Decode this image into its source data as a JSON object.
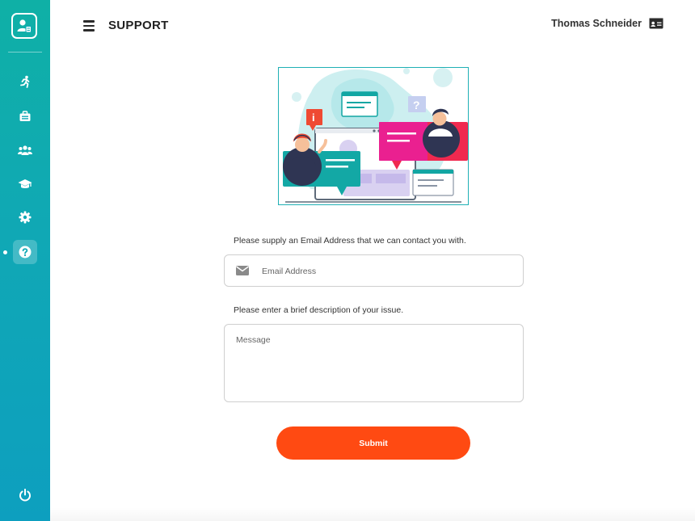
{
  "header": {
    "title": "SUPPORT",
    "user_name": "Thomas Schneider"
  },
  "sidebar": {
    "items": [
      {
        "name": "running-person-icon"
      },
      {
        "name": "briefcase-icon"
      },
      {
        "name": "users-icon"
      },
      {
        "name": "graduation-cap-icon"
      },
      {
        "name": "gear-icon"
      },
      {
        "name": "question-icon",
        "active": true
      }
    ],
    "logout_icon": "power-icon"
  },
  "form": {
    "email_label": "Please supply an Email Address that we can contact you with.",
    "email_placeholder": "Email Address",
    "message_label": "Please enter a brief description of your issue.",
    "message_placeholder": "Message",
    "submit_label": "Submit"
  },
  "colors": {
    "sidebar_top": "#0fb0a6",
    "sidebar_bottom": "#0d9fbf",
    "accent": "#ff4a12",
    "teal": "#1fb0b5"
  }
}
